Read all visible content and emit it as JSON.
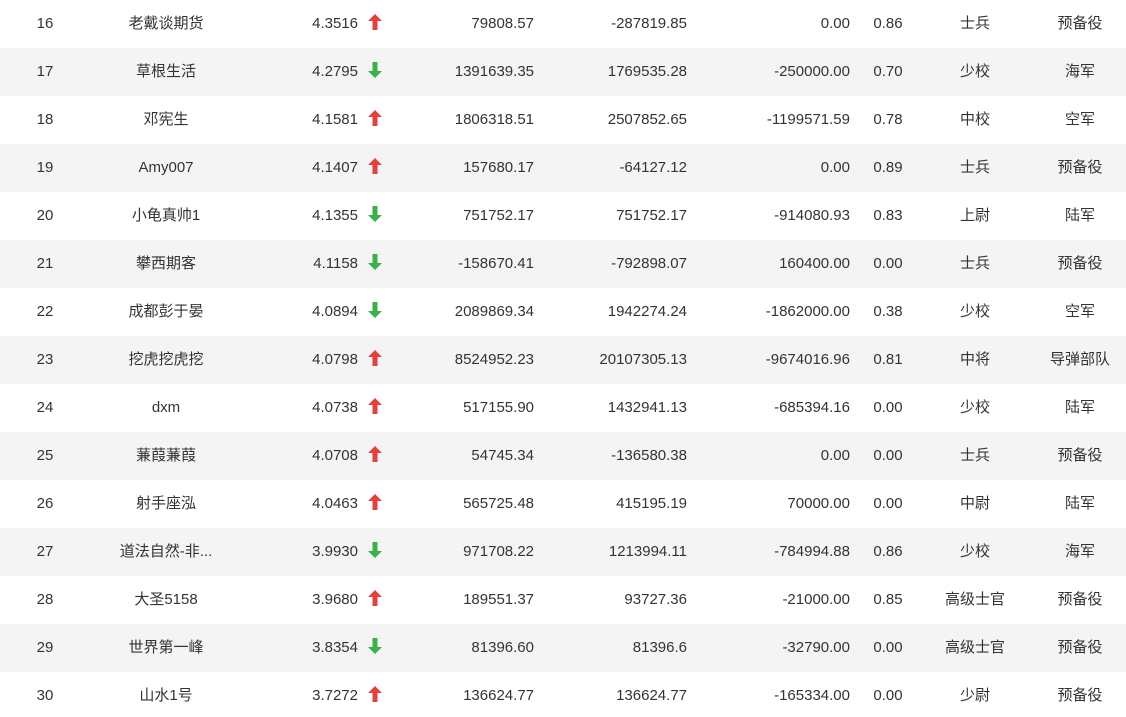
{
  "table": {
    "rows": [
      {
        "rank": "16",
        "name": "老戴谈期货",
        "score": "4.3516",
        "trend": "up",
        "v1": "79808.57",
        "v2": "-287819.85",
        "v3": "0.00",
        "ratio": "0.86",
        "rank_title": "士兵",
        "branch": "预备役"
      },
      {
        "rank": "17",
        "name": "草根生活",
        "score": "4.2795",
        "trend": "down",
        "v1": "1391639.35",
        "v2": "1769535.28",
        "v3": "-250000.00",
        "ratio": "0.70",
        "rank_title": "少校",
        "branch": "海军"
      },
      {
        "rank": "18",
        "name": "邓宪生",
        "score": "4.1581",
        "trend": "up",
        "v1": "1806318.51",
        "v2": "2507852.65",
        "v3": "-1199571.59",
        "ratio": "0.78",
        "rank_title": "中校",
        "branch": "空军"
      },
      {
        "rank": "19",
        "name": "Amy007",
        "score": "4.1407",
        "trend": "up",
        "v1": "157680.17",
        "v2": "-64127.12",
        "v3": "0.00",
        "ratio": "0.89",
        "rank_title": "士兵",
        "branch": "预备役"
      },
      {
        "rank": "20",
        "name": "小龟真帅1",
        "score": "4.1355",
        "trend": "down",
        "v1": "751752.17",
        "v2": "751752.17",
        "v3": "-914080.93",
        "ratio": "0.83",
        "rank_title": "上尉",
        "branch": "陆军"
      },
      {
        "rank": "21",
        "name": "攀西期客",
        "score": "4.1158",
        "trend": "down",
        "v1": "-158670.41",
        "v2": "-792898.07",
        "v3": "160400.00",
        "ratio": "0.00",
        "rank_title": "士兵",
        "branch": "预备役"
      },
      {
        "rank": "22",
        "name": "成都彭于晏",
        "score": "4.0894",
        "trend": "down",
        "v1": "2089869.34",
        "v2": "1942274.24",
        "v3": "-1862000.00",
        "ratio": "0.38",
        "rank_title": "少校",
        "branch": "空军"
      },
      {
        "rank": "23",
        "name": "挖虎挖虎挖",
        "score": "4.0798",
        "trend": "up",
        "v1": "8524952.23",
        "v2": "20107305.13",
        "v3": "-9674016.96",
        "ratio": "0.81",
        "rank_title": "中将",
        "branch": "导弹部队"
      },
      {
        "rank": "24",
        "name": "dxm",
        "score": "4.0738",
        "trend": "up",
        "v1": "517155.90",
        "v2": "1432941.13",
        "v3": "-685394.16",
        "ratio": "0.00",
        "rank_title": "少校",
        "branch": "陆军"
      },
      {
        "rank": "25",
        "name": "蒹葭蒹葭",
        "score": "4.0708",
        "trend": "up",
        "v1": "54745.34",
        "v2": "-136580.38",
        "v3": "0.00",
        "ratio": "0.00",
        "rank_title": "士兵",
        "branch": "预备役"
      },
      {
        "rank": "26",
        "name": "射手座泓",
        "score": "4.0463",
        "trend": "up",
        "v1": "565725.48",
        "v2": "415195.19",
        "v3": "70000.00",
        "ratio": "0.00",
        "rank_title": "中尉",
        "branch": "陆军"
      },
      {
        "rank": "27",
        "name": "道法自然-非...",
        "score": "3.9930",
        "trend": "down",
        "v1": "971708.22",
        "v2": "1213994.11",
        "v3": "-784994.88",
        "ratio": "0.86",
        "rank_title": "少校",
        "branch": "海军"
      },
      {
        "rank": "28",
        "name": "大圣5158",
        "score": "3.9680",
        "trend": "up",
        "v1": "189551.37",
        "v2": "93727.36",
        "v3": "-21000.00",
        "ratio": "0.85",
        "rank_title": "高级士官",
        "branch": "预备役"
      },
      {
        "rank": "29",
        "name": "世界第一峰",
        "score": "3.8354",
        "trend": "down",
        "v1": "81396.60",
        "v2": "81396.6",
        "v3": "-32790.00",
        "ratio": "0.00",
        "rank_title": "高级士官",
        "branch": "预备役"
      },
      {
        "rank": "30",
        "name": "山水1号",
        "score": "3.7272",
        "trend": "up",
        "v1": "136624.77",
        "v2": "136624.77",
        "v3": "-165334.00",
        "ratio": "0.00",
        "rank_title": "少尉",
        "branch": "预备役"
      }
    ],
    "colors": {
      "up": "#e04040",
      "down": "#3cb04c",
      "stripe": "#f4f4f4"
    },
    "icons": {
      "up": "arrow-up-icon",
      "down": "arrow-down-icon"
    }
  }
}
